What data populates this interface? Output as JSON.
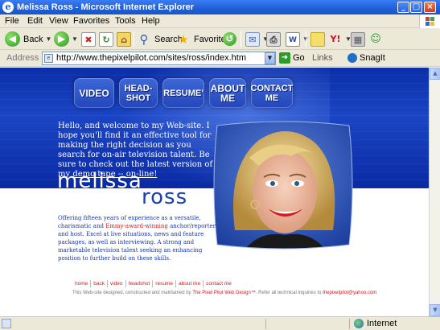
{
  "window": {
    "title": "Melissa Ross - Microsoft Internet Explorer",
    "minimize": "_",
    "maximize": "□",
    "close": "×"
  },
  "menu": [
    "File",
    "Edit",
    "View",
    "Favorites",
    "Tools",
    "Help"
  ],
  "toolbar": {
    "back": "Back",
    "search": "Search",
    "favorites": "Favorites"
  },
  "address": {
    "label": "Address",
    "url": "http://www.thepixelpilot.com/sites/ross/index.htm",
    "go": "Go",
    "links": "Links",
    "snagit": "SnagIt"
  },
  "site": {
    "nav": [
      {
        "label": "VIDEO"
      },
      {
        "label": "HEAD-\nSHOT"
      },
      {
        "label": "RESUME'"
      },
      {
        "label": "ABOUT\nME"
      },
      {
        "label": "CONTACT\nME"
      }
    ],
    "welcome_text": "Hello, and welcome to my Web-site. I hope you'll find it an effective tool for making the right decision as you search for on-air television talent. Be sure to check out the latest version of my ",
    "demo_link": "demo tape -- on-line!",
    "name_first": "melissa",
    "name_last": "ross",
    "bio_part1": "Offering fifteen years of experience as a versatile, charismatic and ",
    "bio_highlight": "Emmy-award-winning",
    "bio_part2": " anchor/reporter and host. Excel at live situations, news and feature packages, as well as interviewing. A strong and marketable television talent seeking an enhancing position to further build on these skills.",
    "footer_links": [
      "home",
      "back",
      "video",
      "headshot",
      "resume",
      "about me",
      "contact me"
    ],
    "credit_prefix": "This Web-site designed, constructed and maintained by ",
    "credit_company": "The Pixel Pilot Web Design™",
    "credit_middle": ". Refer all technical inquiries to ",
    "credit_email": "thepixelpilot@yahoo.com"
  },
  "status": {
    "zone": "Internet"
  },
  "colors": {
    "banner_blue": "#1b45c4",
    "link_red": "#d4171d",
    "bio_blue": "#1736a8"
  }
}
